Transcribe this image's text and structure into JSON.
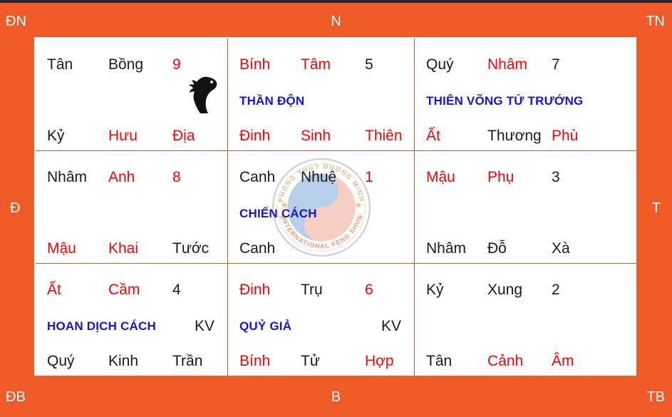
{
  "page": {
    "title": "Ban do Ky Mon Don Giap",
    "frame_color": "#f05a28",
    "grid_bg": "#ffffff",
    "grid_line_color": "#e2571f"
  },
  "directions": {
    "top_left": "ĐN",
    "top_center": "N",
    "top_right": "TN",
    "middle_left": "Đ",
    "middle_right": "T",
    "bottom_left": "ĐB",
    "bottom_center": "B",
    "bottom_right": "TB"
  },
  "colors": {
    "black": "#1a1a1a",
    "red": "#fe0000",
    "blue": "#1414e0"
  },
  "watermark": {
    "outer_text_top": "PHONG THUY DUONG MINH",
    "outer_text_bottom": "INTERNATIONAL FENG SHUI",
    "icon": "yin-yang-logo"
  },
  "cells": [
    {
      "id": "palace-9",
      "position": "top-left",
      "top": {
        "a": "Tân",
        "b": "Bồng",
        "c": "9"
      },
      "special": "",
      "kv": "",
      "icon": "horse-icon",
      "bottom": {
        "a": "Kỷ",
        "b": "Hưu",
        "c": "Địa"
      }
    },
    {
      "id": "palace-5",
      "position": "top-center",
      "top": {
        "a": "Bính",
        "b": "Tâm",
        "c": "5"
      },
      "special": "THẦN ĐỘN",
      "kv": "",
      "icon": "",
      "bottom": {
        "a": "Đinh",
        "b": "Sinh",
        "c": "Thiên"
      }
    },
    {
      "id": "palace-7",
      "position": "top-right",
      "top": {
        "a": "Quý",
        "b": "Nhâm",
        "c": "7"
      },
      "special": "THIÊN VÕNG TỨ TRƯỚNG",
      "kv": "",
      "icon": "",
      "bottom": {
        "a": "Ất",
        "b": "Thương",
        "c": "Phù"
      }
    },
    {
      "id": "palace-8",
      "position": "middle-left",
      "top": {
        "a": "Nhâm",
        "b": "Anh",
        "c": "8"
      },
      "special": "",
      "kv": "",
      "icon": "",
      "bottom": {
        "a": "Mậu",
        "b": "Khai",
        "c": "Tước"
      }
    },
    {
      "id": "palace-1",
      "position": "middle-center",
      "top": {
        "a": "Canh",
        "b": "Nhuệ",
        "c": "1"
      },
      "special": "CHIẾN CÁCH",
      "kv": "",
      "icon": "yin-yang-logo",
      "bottom": {
        "a": "Canh",
        "b": "",
        "c": ""
      }
    },
    {
      "id": "palace-3",
      "position": "middle-right",
      "top": {
        "a": "Mậu",
        "b": "Phụ",
        "c": "3"
      },
      "special": "",
      "kv": "",
      "icon": "",
      "bottom": {
        "a": "Nhâm",
        "b": "Đỗ",
        "c": "Xà"
      }
    },
    {
      "id": "palace-4",
      "position": "bottom-left",
      "top": {
        "a": "Ất",
        "b": "Cầm",
        "c": "4"
      },
      "special": "HOAN DỊCH CÁCH",
      "kv": "KV",
      "icon": "",
      "bottom": {
        "a": "Quý",
        "b": "Kinh",
        "c": "Trần"
      }
    },
    {
      "id": "palace-6",
      "position": "bottom-center",
      "top": {
        "a": "Đinh",
        "b": "Trụ",
        "c": "6"
      },
      "special": "QUỶ GIẢ",
      "kv": "KV",
      "icon": "",
      "bottom": {
        "a": "Bính",
        "b": "Tử",
        "c": "Hợp"
      }
    },
    {
      "id": "palace-2",
      "position": "bottom-right",
      "top": {
        "a": "Kỷ",
        "b": "Xung",
        "c": "2"
      },
      "special": "",
      "kv": "",
      "icon": "",
      "bottom": {
        "a": "Tân",
        "b": "Cảnh",
        "c": "Âm"
      }
    }
  ]
}
